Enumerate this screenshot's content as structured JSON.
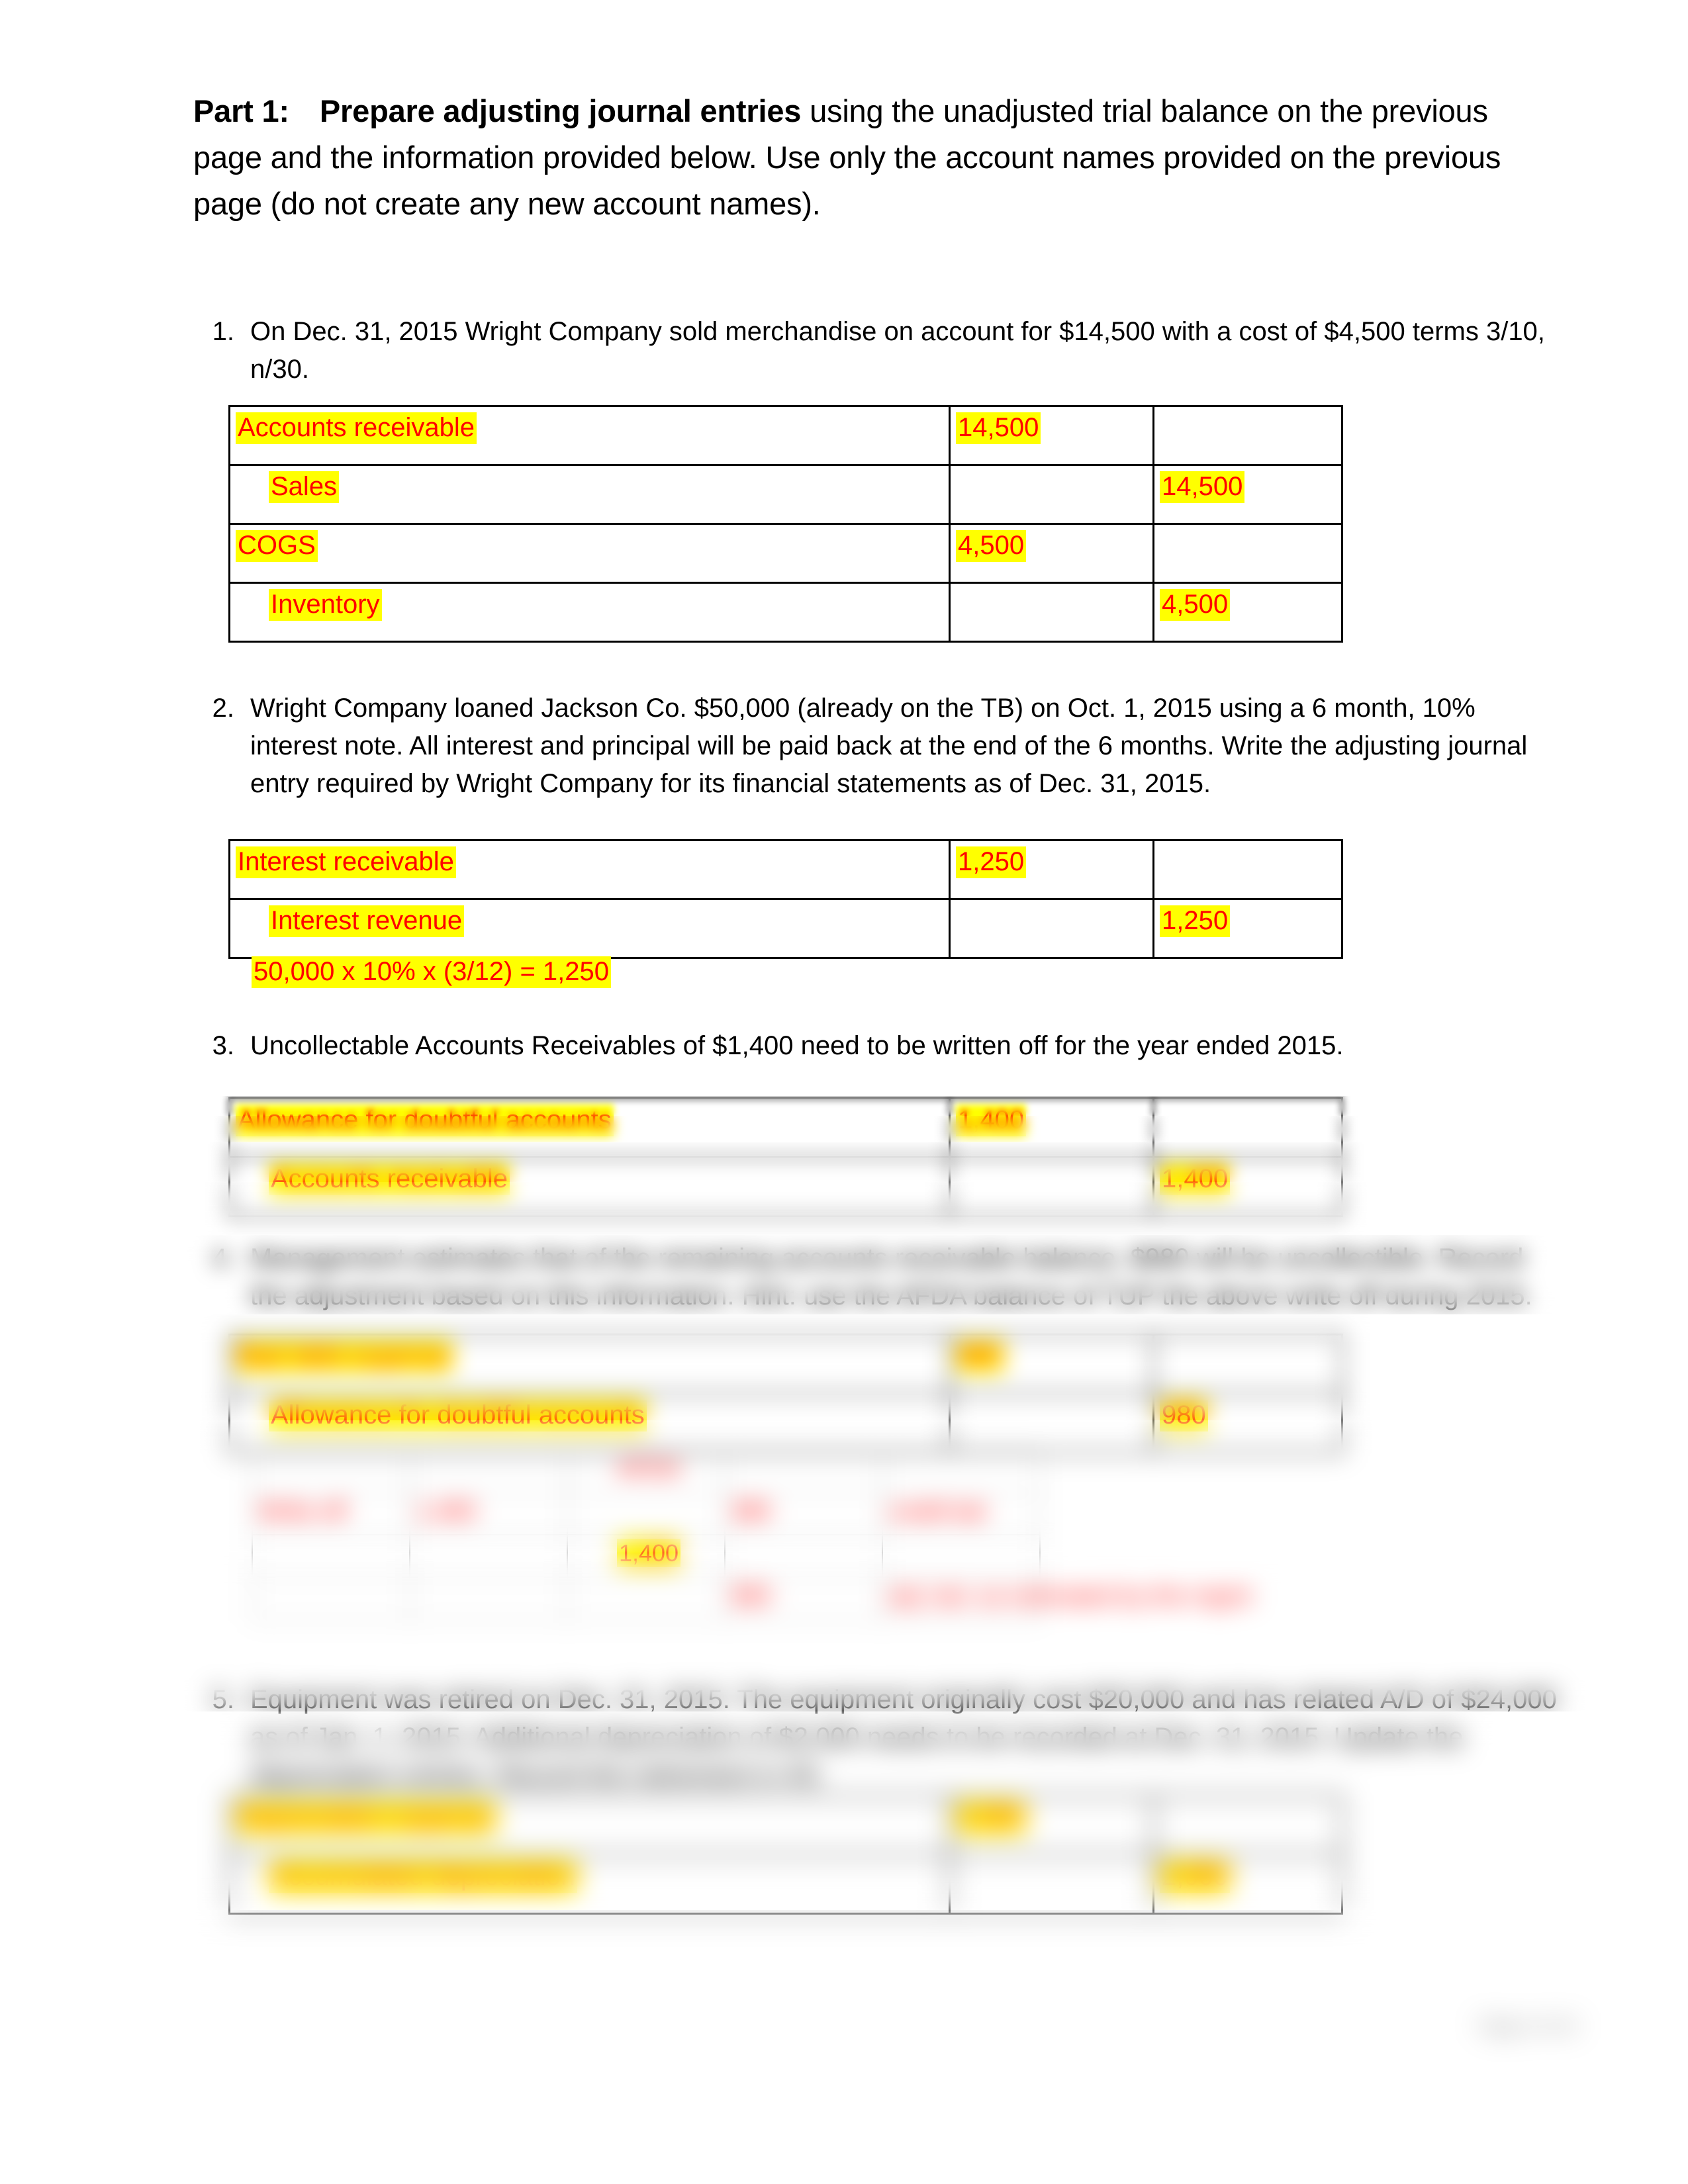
{
  "heading": {
    "part_label": "Part 1:",
    "bold_title": "Prepare adjusting journal entries",
    "rest": " using the unadjusted trial balance on the previous page and the information provided below.  Use only the account names provided on the previous page (do not create any new account names)."
  },
  "items": [
    {
      "number": "1.",
      "text": "On Dec. 31, 2015 Wright Company sold merchandise on account for $14,500 with a cost of $4,500 terms 3/10, n/30.",
      "entries": [
        {
          "account": "Accounts receivable",
          "indented": false,
          "debit": "14,500",
          "credit": ""
        },
        {
          "account": "Sales",
          "indented": true,
          "debit": "",
          "credit": "14,500"
        },
        {
          "account": "COGS",
          "indented": false,
          "debit": "4,500",
          "credit": ""
        },
        {
          "account": "Inventory",
          "indented": true,
          "debit": "",
          "credit": "4,500"
        }
      ]
    },
    {
      "number": "2.",
      "text": "Wright Company loaned Jackson Co. $50,000 (already on the TB) on Oct. 1, 2015 using a 6 month, 10% interest note.  All interest and principal will be paid back at the end of the 6 months.  Write the adjusting journal entry required by Wright Company for its financial statements as of Dec. 31, 2015.",
      "entries": [
        {
          "account": "Interest receivable",
          "indented": false,
          "debit": "1,250",
          "credit": ""
        },
        {
          "account": "Interest revenue",
          "indented": true,
          "debit": "",
          "credit": "1,250"
        }
      ],
      "formula": "50,000 x 10% x (3/12) = 1,250"
    },
    {
      "number": "3.",
      "text": "Uncollectable Accounts Receivables of $1,400 need to be written off for the year ended 2015.",
      "entries": [
        {
          "account": "Allowance for doubtful accounts",
          "indented": false,
          "debit": "1,400",
          "credit": ""
        },
        {
          "account": "Accounts receivable",
          "indented": true,
          "debit": "",
          "credit": "1,400"
        }
      ]
    },
    {
      "number": "4.",
      "text": "Management estimates that of the remaining accounts receivable balance, $980 will be uncollectible.  Record the adjustment based on this information.  Hint: use the AFDA balance of TUP the above write off during 2015.",
      "entries": [
        {
          "account": "Bad debt expense",
          "indented": false,
          "debit": "980",
          "credit": ""
        },
        {
          "account": "Allowance for doubtful accounts",
          "indented": true,
          "debit": "",
          "credit": "980"
        }
      ],
      "work_table": {
        "rows": [
          [
            "",
            "",
            "AFDA",
            "",
            ""
          ],
          [
            "Write off",
            "1,400",
            "",
            "380",
            "credit bal"
          ],
          [
            "",
            "",
            "1,400",
            "",
            ""
          ],
          [
            "",
            "",
            "",
            "980",
            "adj. bal. as estimated by the mgmt"
          ]
        ]
      }
    },
    {
      "number": "5.",
      "text": "Equipment was retired on Dec. 31, 2015.  The equipment originally cost $20,000 and has related A/D of $24,000 as of Jan. 1, 2015.  Additional depreciation of $2,000 needs to be recorded at Dec. 31, 2015.  Update the depreciation entries.  Record the retirement in #6.",
      "entries": [
        {
          "account": "Depreciation expense",
          "indented": false,
          "debit": "2,000",
          "credit": ""
        },
        {
          "account": "Accumulated depreciation",
          "indented": true,
          "debit": "",
          "credit": "2,000"
        }
      ]
    }
  ],
  "footer": "Page 2 of 10"
}
